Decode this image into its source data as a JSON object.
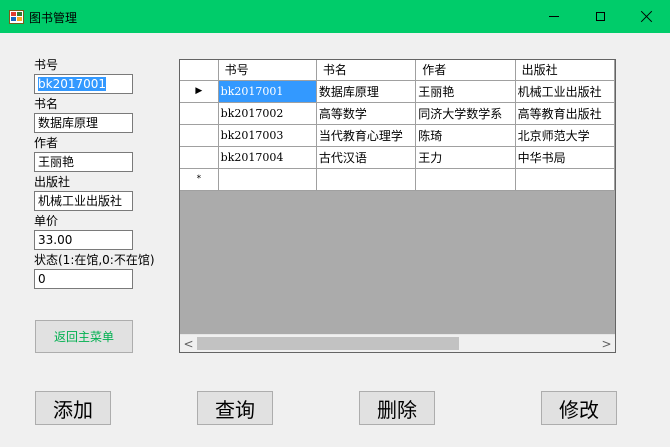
{
  "window": {
    "title": "图书管理",
    "title_bar_color": "#00cc6a",
    "controls": [
      "minimize-icon",
      "maximize-icon",
      "close-icon"
    ]
  },
  "form": {
    "book_id_label": "书号",
    "book_id_value": "bk2017001",
    "title_label": "书名",
    "title_value": "数据库原理",
    "author_label": "作者",
    "author_value": "王丽艳",
    "publisher_label": "出版社",
    "publisher_value": "机械工业出版社",
    "price_label": "单价",
    "price_value": "33.00",
    "status_label": "状态(1:在馆,0:不在馆)",
    "status_value": "0",
    "return_label": "返回主菜单",
    "return_color": "#00b050"
  },
  "actions": {
    "add_label": "添加",
    "query_label": "查询",
    "delete_label": "删除",
    "modify_label": "修改"
  },
  "grid": {
    "columns": [
      "书号",
      "书名",
      "作者",
      "出版社"
    ],
    "current_row_marker": "▶",
    "new_row_marker": "*",
    "rows": [
      [
        "bk2017001",
        "数据库原理",
        "王丽艳",
        "机械工业出版社"
      ],
      [
        "bk2017002",
        "高等数学",
        "同济大学数学系",
        "高等教育出版社"
      ],
      [
        "bk2017003",
        "当代教育心理学",
        "陈琦",
        "北京师范大学"
      ],
      [
        "bk2017004",
        "古代汉语",
        "王力",
        "中华书局"
      ]
    ],
    "selection_color": "#3399ff",
    "scroll_left": "<",
    "scroll_right": ">"
  }
}
